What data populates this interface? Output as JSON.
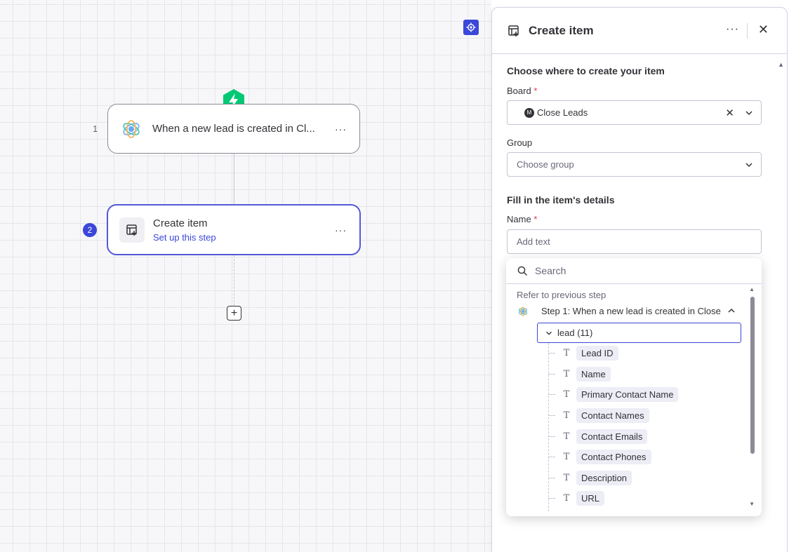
{
  "canvas": {
    "trigger": {
      "number": "1",
      "title": "When a new lead is created in Cl...",
      "menu": "···"
    },
    "action": {
      "number": "2",
      "title": "Create item",
      "subtitle": "Set up this step",
      "menu": "···"
    },
    "add_step": "+"
  },
  "panel": {
    "title": "Create item",
    "more": "···",
    "close": "✕",
    "section_where": "Choose where to create your item",
    "board_label": "Board",
    "required_mark": "*",
    "board_avatar": "M",
    "board_value": "Close Leads",
    "board_clear": "✕",
    "group_label": "Group",
    "group_placeholder": "Choose group",
    "section_details": "Fill in the item's details",
    "name_label": "Name",
    "name_placeholder": "Add text"
  },
  "dropdown": {
    "search_placeholder": "Search",
    "refer_label": "Refer to previous step",
    "step_label": "Step 1: When a new lead is created in Close",
    "lead_group": "lead (11)",
    "field_type_glyph": "T",
    "items": [
      "Lead ID",
      "Name",
      "Primary Contact Name",
      "Contact Names",
      "Contact Emails",
      "Contact Phones",
      "Description",
      "URL"
    ]
  },
  "colors": {
    "accent": "#3b47d9",
    "trigger_green": "#00c875",
    "required": "#d83a52"
  }
}
